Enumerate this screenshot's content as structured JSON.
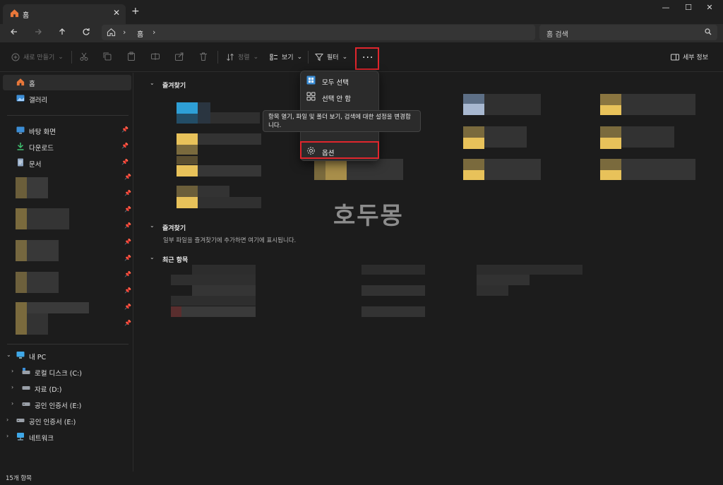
{
  "window": {
    "tab_title": "홈",
    "new_tab_symbol": "+",
    "tab_close_symbol": "✕",
    "min_symbol": "—",
    "max_symbol": "☐",
    "close_symbol": "✕"
  },
  "address": {
    "crumb": "홈",
    "search_placeholder": "홈 검색"
  },
  "toolbar": {
    "new_label": "새로 만들기",
    "sort_label": "정렬",
    "view_label": "보기",
    "filter_label": "필터",
    "more_symbol": "···",
    "details_label": "세부 정보"
  },
  "sidebar": {
    "home": "홈",
    "gallery": "갤러리",
    "desktop": "바탕 화면",
    "downloads": "다운로드",
    "documents": "문서",
    "pc": "내 PC",
    "drive_c": "로컬 디스크 (C:)",
    "drive_d": "자료 (D:)",
    "drive_e": "공인 인증서 (E:)",
    "drive_e2": "공인 인증서 (E:)",
    "network": "네트워크"
  },
  "main": {
    "section1": "즐겨찾기",
    "section2": "즐겨찾기",
    "section2_hint": "일부 파일을 즐겨찾기에 추가하면 여기에 표시됩니다.",
    "section3": "최근 항목"
  },
  "menu": {
    "select_all": "모두 선택",
    "select_none": "선택 안 함",
    "options": "옵션",
    "tooltip": "항목 열기, 파일 및 폴더 보기, 검색에 대한 설정을 변경합니다."
  },
  "watermark": "호두몽",
  "status": {
    "count": "15개 항목"
  },
  "colors": {
    "accent_red": "#e0262d",
    "folder_yellow": "#e8c25a",
    "bg": "#1c1c1c"
  }
}
